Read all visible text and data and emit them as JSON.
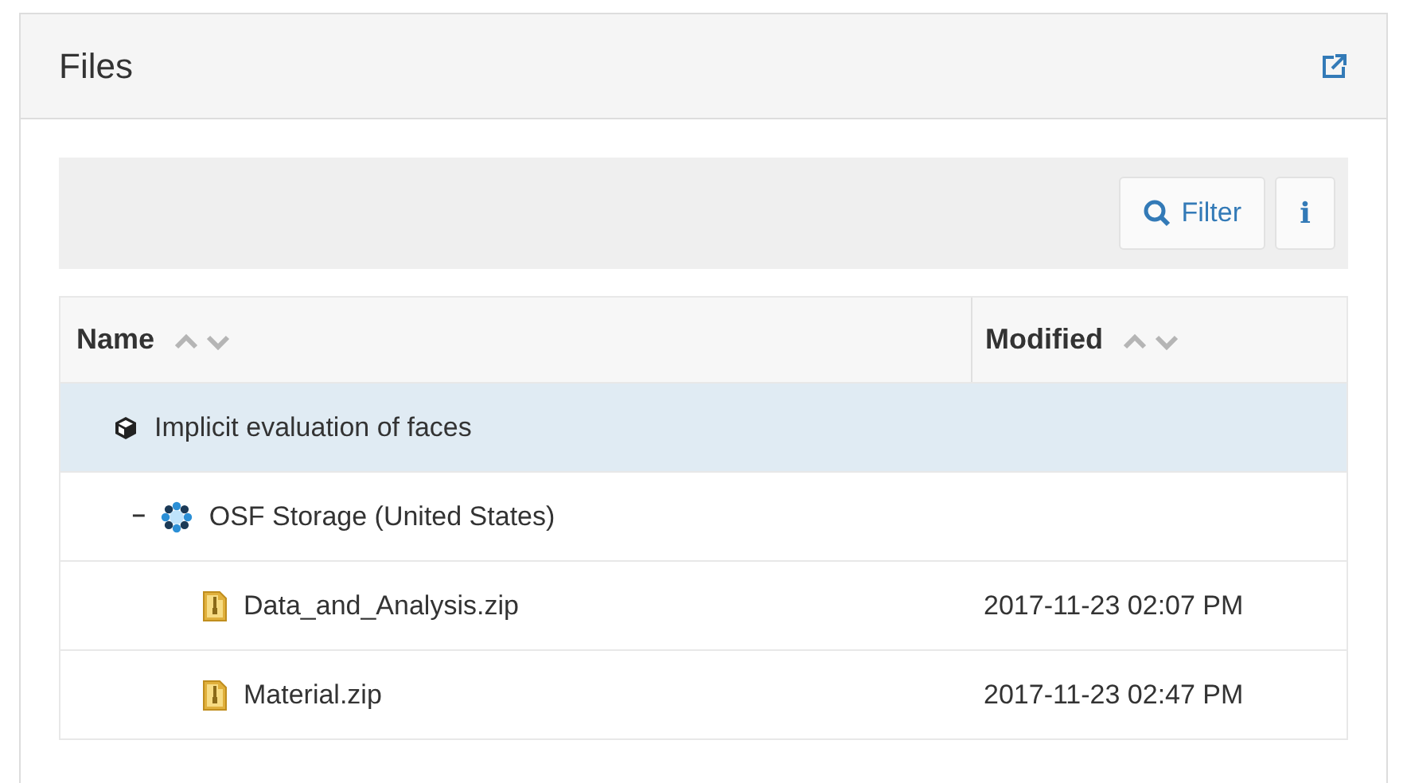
{
  "panel": {
    "title": "Files"
  },
  "toolbar": {
    "filter_button": "Filter",
    "info_button": "i"
  },
  "table": {
    "columns": [
      {
        "label": "Name"
      },
      {
        "label": "Modified"
      }
    ],
    "tree": [
      {
        "kind": "project",
        "name": "Implicit evaluation of faces",
        "selected": true,
        "children": [
          {
            "kind": "storage",
            "name": "OSF Storage (United States)",
            "expanded": true,
            "toggle": "–",
            "selected": false,
            "children": [
              {
                "kind": "file",
                "name": "Data_and_Analysis.zip",
                "modified": "2017-11-23 02:07 PM",
                "selected": false
              },
              {
                "kind": "file",
                "name": "Material.zip",
                "modified": "2017-11-23 02:47 PM",
                "selected": false
              }
            ]
          }
        ]
      }
    ]
  }
}
